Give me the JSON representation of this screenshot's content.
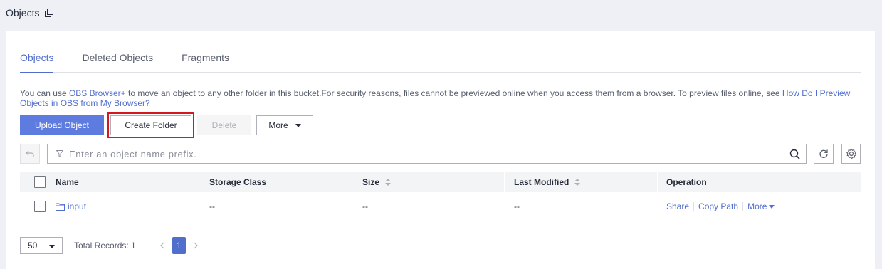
{
  "page": {
    "title": "Objects"
  },
  "tabs": [
    {
      "label": "Objects",
      "active": true
    },
    {
      "label": "Deleted Objects",
      "active": false
    },
    {
      "label": "Fragments",
      "active": false
    }
  ],
  "info": {
    "prefix": "You can use ",
    "link1": "OBS Browser+",
    "middle": " to move an object to any other folder in this bucket.For security reasons, files cannot be previewed online when you access them from a browser. To preview files online, see ",
    "link2": "How Do I Preview Objects in OBS from My Browser?"
  },
  "toolbar": {
    "upload_label": "Upload Object",
    "create_label": "Create Folder",
    "delete_label": "Delete",
    "more_label": "More"
  },
  "search": {
    "placeholder": "Enter an object name prefix."
  },
  "table": {
    "columns": {
      "name": "Name",
      "storage_class": "Storage Class",
      "size": "Size",
      "last_modified": "Last Modified",
      "operation": "Operation"
    },
    "rows": [
      {
        "name": "input",
        "storage_class": "--",
        "size": "--",
        "last_modified": "--",
        "ops": {
          "share": "Share",
          "copy_path": "Copy Path",
          "more": "More"
        }
      }
    ]
  },
  "pager": {
    "page_size": "50",
    "total_label": "Total Records: 1",
    "current_page": "1"
  },
  "colors": {
    "primary": "#5e7ce0",
    "link": "#526ecc",
    "highlight": "#d31920"
  },
  "icons": [
    "copy-icon",
    "back-icon",
    "filter-icon",
    "search-icon",
    "refresh-icon",
    "settings-icon",
    "folder-icon",
    "chevron-left-icon",
    "chevron-right-icon"
  ]
}
